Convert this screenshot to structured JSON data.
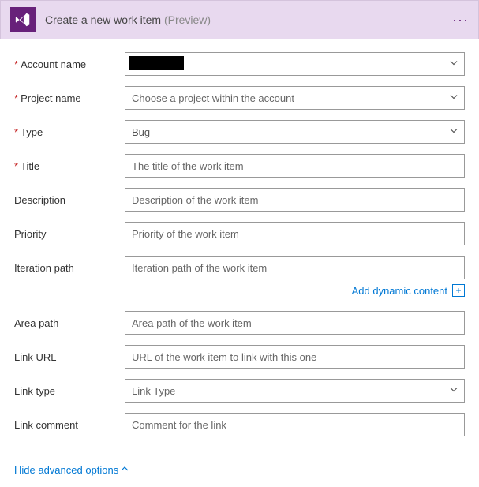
{
  "header": {
    "title": "Create a new work item",
    "preview": "(Preview)"
  },
  "fields": {
    "account": {
      "label": "Account name",
      "value": ""
    },
    "project": {
      "label": "Project name",
      "placeholder": "Choose a project within the account"
    },
    "type": {
      "label": "Type",
      "value": "Bug"
    },
    "title": {
      "label": "Title",
      "placeholder": "The title of the work item"
    },
    "description": {
      "label": "Description",
      "placeholder": "Description of the work item"
    },
    "priority": {
      "label": "Priority",
      "placeholder": "Priority of the work item"
    },
    "iteration": {
      "label": "Iteration path",
      "placeholder": "Iteration path of the work item"
    },
    "area": {
      "label": "Area path",
      "placeholder": "Area path of the work item"
    },
    "linkurl": {
      "label": "Link URL",
      "placeholder": "URL of the work item to link with this one"
    },
    "linktype": {
      "label": "Link type",
      "placeholder": "Link Type"
    },
    "linkcomment": {
      "label": "Link comment",
      "placeholder": "Comment for the link"
    }
  },
  "links": {
    "dynamic": "Add dynamic content",
    "hide": "Hide advanced options"
  }
}
